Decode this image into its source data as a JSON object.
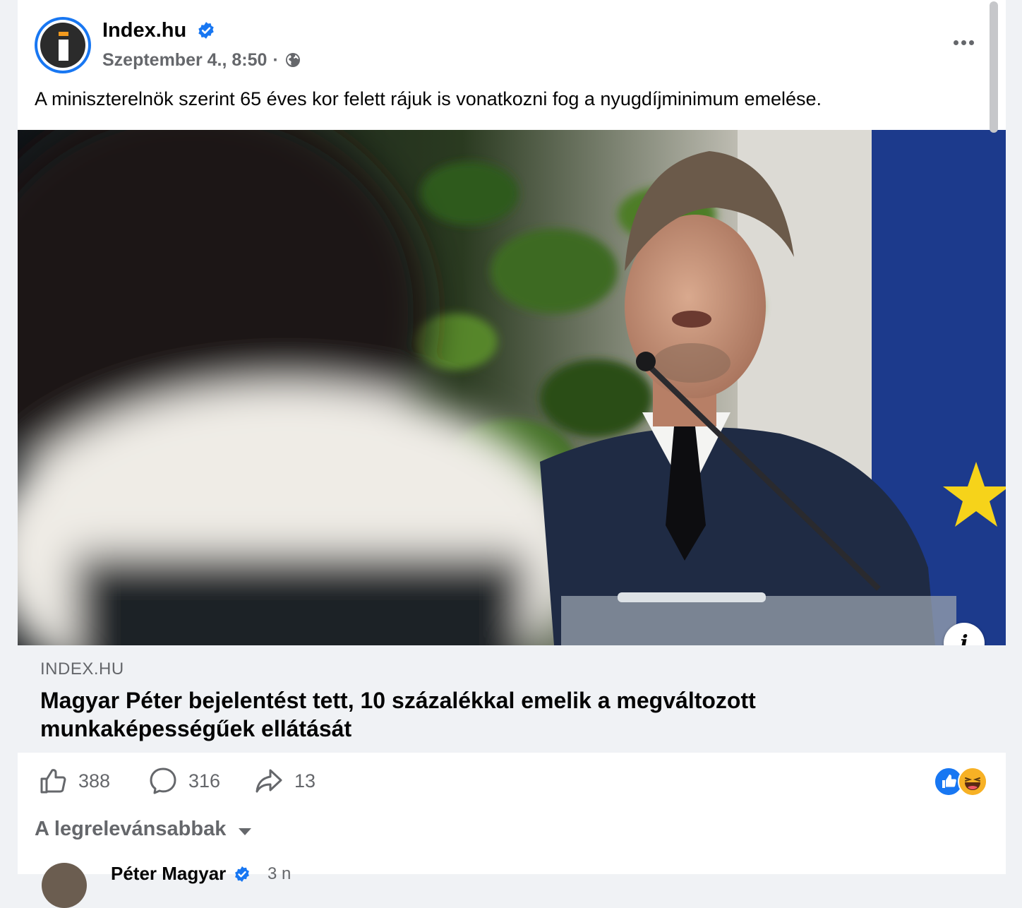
{
  "post": {
    "page_name": "Index.hu",
    "timestamp": "Szeptember 4., 8:50",
    "separator": "·",
    "audience_icon": "globe-icon",
    "caption": "A miniszterelnök szerint 65 éves kor felett rájuk is vonatkozni fog a nyugdíjminimum emelése.",
    "more_icon": "more-options-icon"
  },
  "link_card": {
    "domain": "INDEX.HU",
    "headline": "Magyar Péter bejelentést tett, 10 százalékkal emelik a megváltozott munkaképességűek ellátását",
    "info_icon": "info-icon"
  },
  "actions": {
    "like_count": "388",
    "comment_count": "316",
    "share_count": "13"
  },
  "reactions": [
    "like-reaction-icon",
    "haha-reaction-icon"
  ],
  "comments": {
    "sort_label": "A legrelevánsabbak",
    "first_comment": {
      "author": "Péter Magyar",
      "time": "3 n"
    }
  },
  "colors": {
    "verified_blue": "#1877f2",
    "secondary_text": "#65676b",
    "card_bg": "#f0f2f5"
  }
}
